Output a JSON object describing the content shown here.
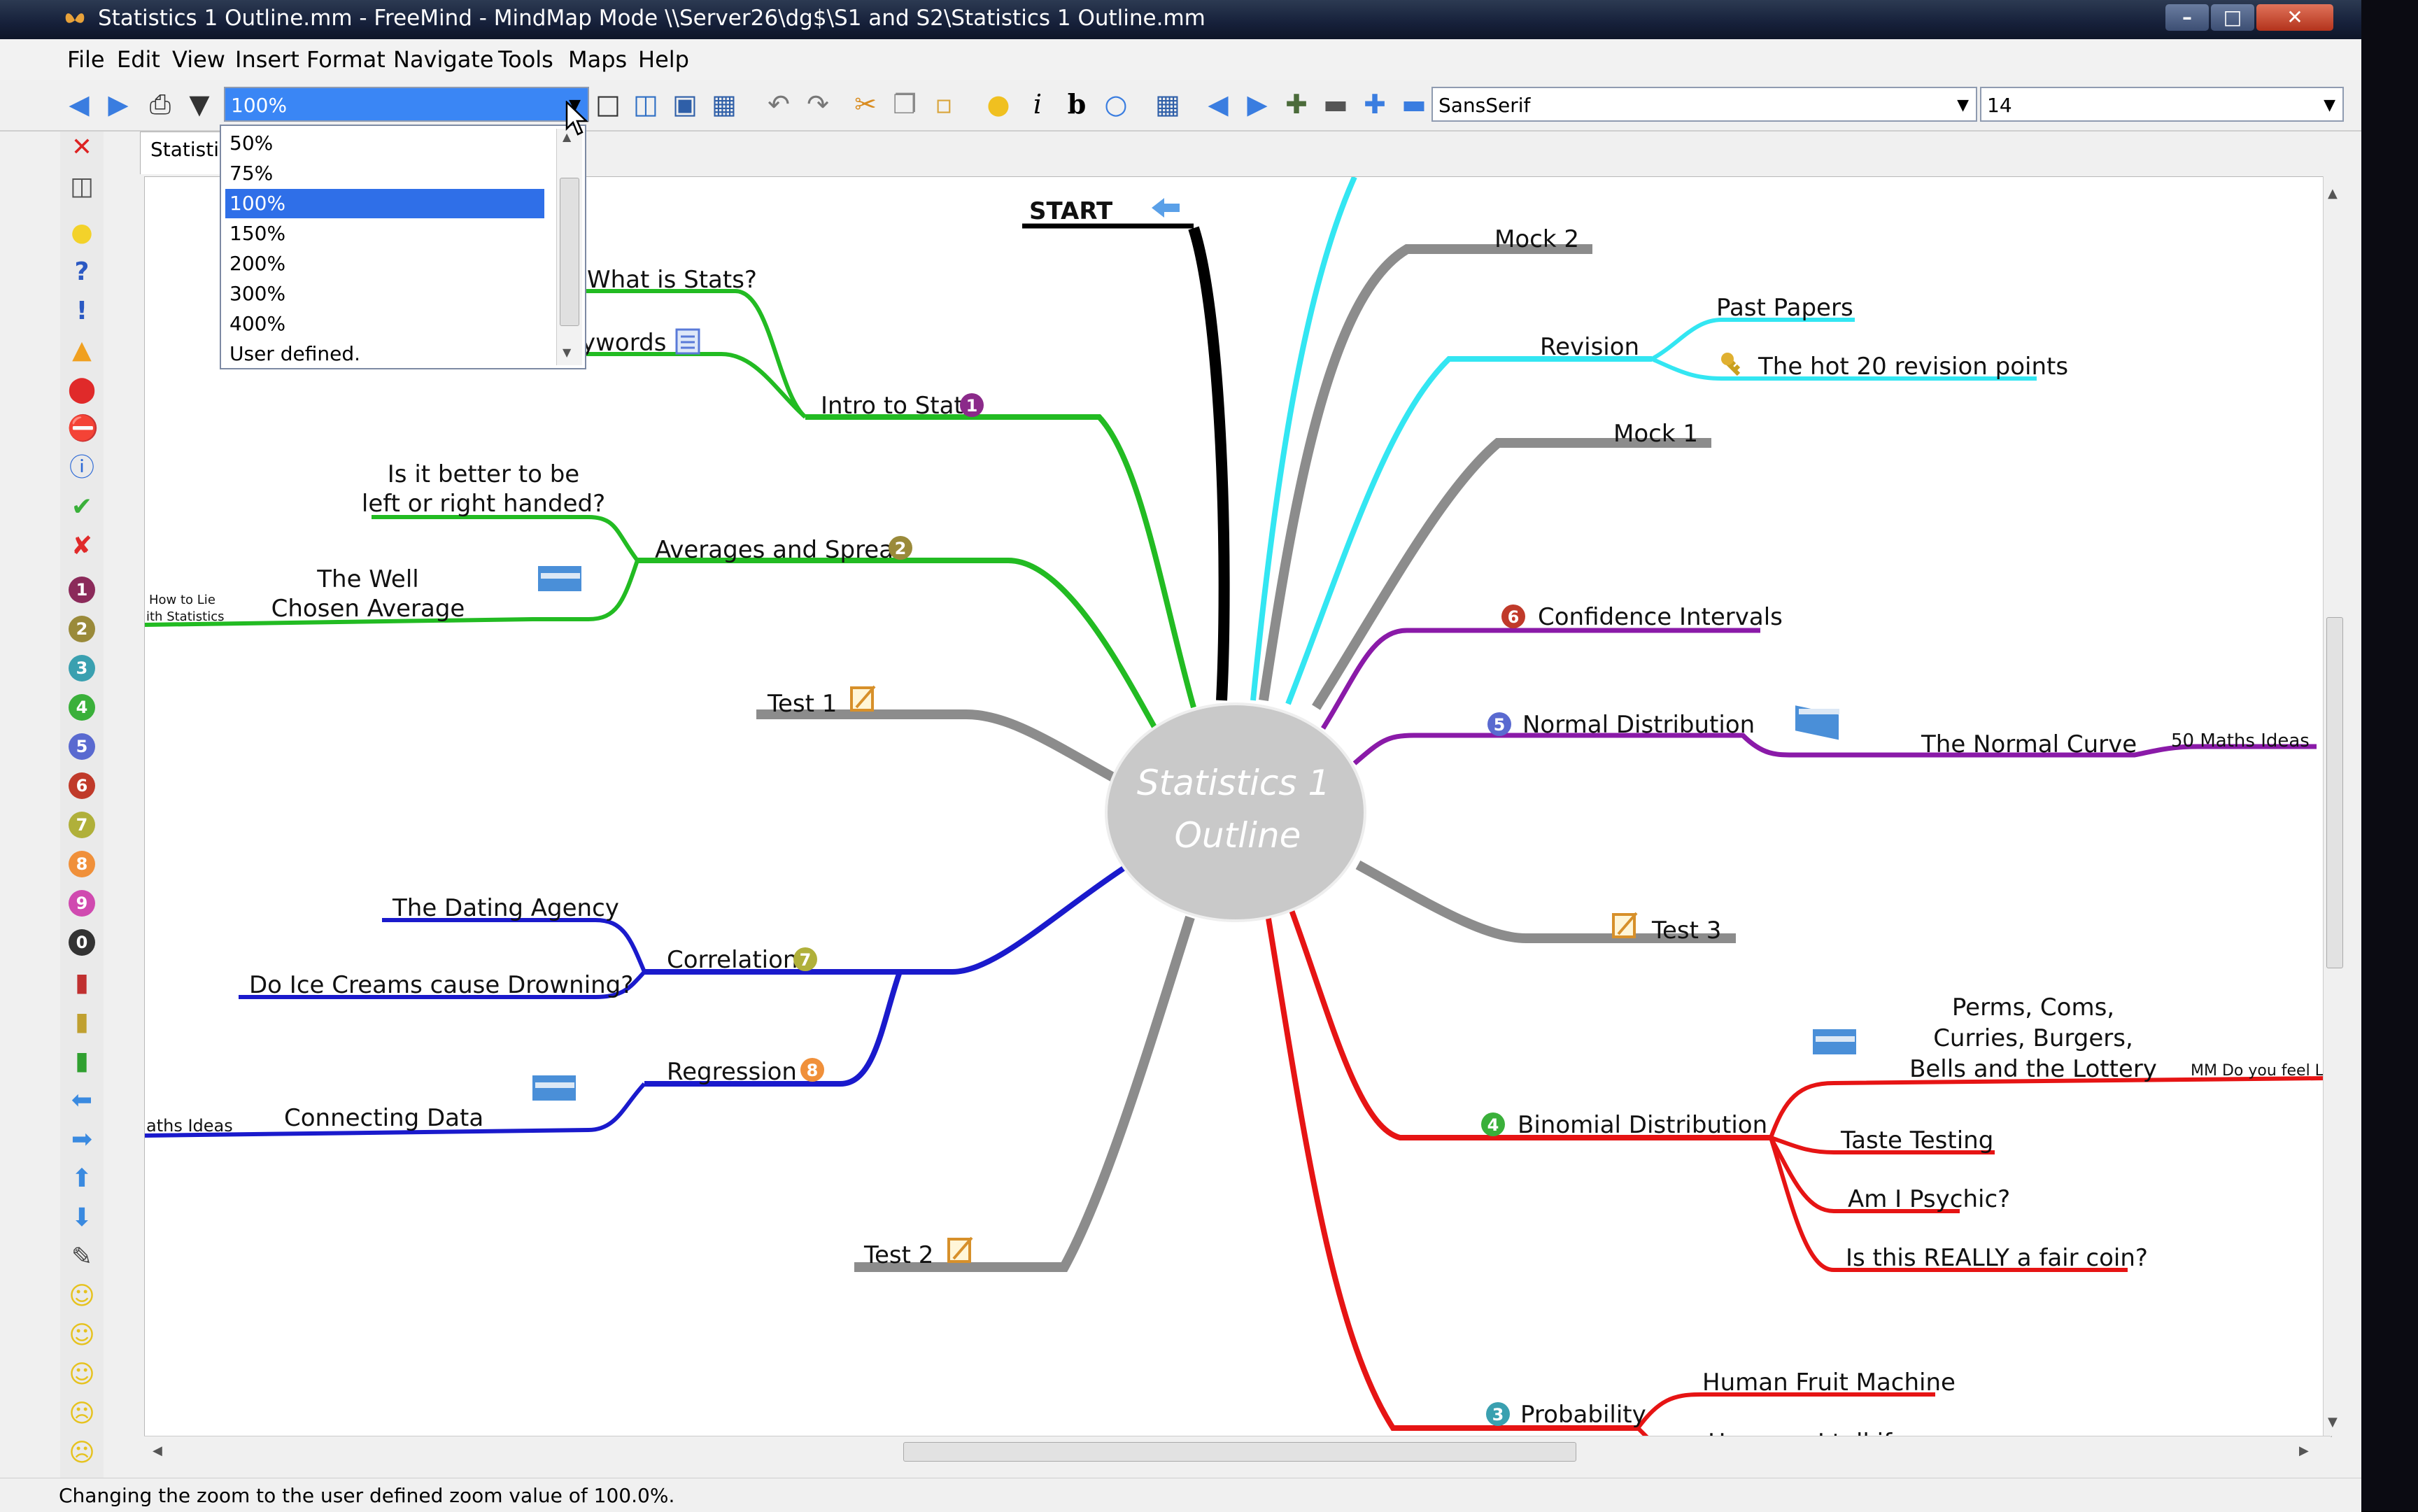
{
  "window": {
    "title": "Statistics 1 Outline.mm - FreeMind - MindMap Mode \\\\Server26\\dg$\\S1 and S2\\Statistics 1 Outline.mm"
  },
  "menu": [
    "File",
    "Edit",
    "View",
    "Insert",
    "Format",
    "Navigate",
    "Tools",
    "Maps",
    "Help"
  ],
  "toolbar": {
    "zoom_value": "100%",
    "font_family": "SansSerif",
    "font_size": "14"
  },
  "zoom_options": [
    "50%",
    "75%",
    "100%",
    "150%",
    "200%",
    "300%",
    "400%",
    "User defined."
  ],
  "zoom_selected_index": 2,
  "tab": {
    "label": "Statisti"
  },
  "left_icons": {
    "priority_numbers": [
      "1",
      "2",
      "3",
      "4",
      "5",
      "6",
      "7",
      "8",
      "9",
      "0"
    ]
  },
  "mindmap": {
    "root": "Statistics 1 Outline",
    "root_lines": [
      "Statistics 1",
      "Outline"
    ],
    "nodes": {
      "start": "START",
      "mock2": "Mock 2",
      "revision": "Revision",
      "past_papers": "Past Papers",
      "hot20": "The hot 20 revision points",
      "mock1": "Mock 1",
      "confidence": "Confidence Intervals",
      "normal": "Normal Distribution",
      "normal_curve": "The Normal Curve",
      "fifty_maths_right": "50 Maths Ideas",
      "test3": "Test 3",
      "perms_l1": "Perms, Coms,",
      "perms_l2": "Curries, Burgers,",
      "perms_l3": "Bells and the Lottery",
      "mm_do_you": "MM Do you feel Lu",
      "binomial": "Binomial Distribution",
      "taste": "Taste Testing",
      "psychic": "Am I Psychic?",
      "fair_coin": "Is this REALLY a fair coin?",
      "probability": "Probability",
      "fruit_machine": "Human Fruit Machine",
      "how_can": "How can I tell if",
      "test2": "Test 2",
      "test1": "Test 1",
      "what_is_stats": "What is Stats?",
      "keywords": "ywords",
      "intro": "Intro to Stats",
      "better_l1": "Is it better to be",
      "better_l2": "left or right handed?",
      "averages": "Averages and Spread",
      "well_l1": "The Well",
      "well_l2": "Chosen Average",
      "how_to_lie_l1": "How to Lie",
      "how_to_lie_l2": "ith Statistics",
      "dating": "The Dating Agency",
      "ice_creams": "Do Ice Creams cause Drowning?",
      "correlation": "Correlation",
      "regression": "Regression",
      "connecting": "Connecting Data",
      "fifty_maths_left": "aths Ideas"
    },
    "badges": {
      "intro": "1",
      "averages": "2",
      "probability": "3",
      "binomial": "4",
      "normal": "5",
      "confidence": "6",
      "correlation": "7",
      "regression": "8"
    },
    "branch_colors": {
      "start": "#000000",
      "tests": "#8c8c8c",
      "revision": "#33e6f2",
      "green": "#22bb22",
      "purple": "#8a1aa8",
      "red": "#e61414",
      "blue": "#1a1acc"
    }
  },
  "status": "Changing the zoom to the user defined zoom value of 100.0%."
}
